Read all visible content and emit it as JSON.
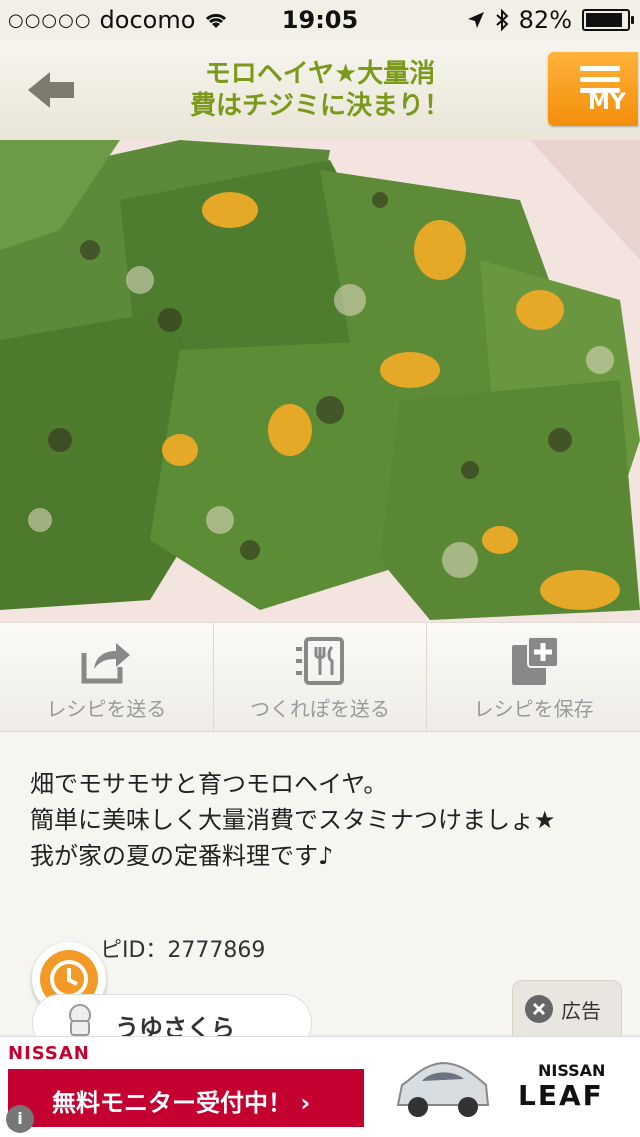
{
  "status": {
    "carrier": "docomo",
    "time": "19:05",
    "battery": "82%",
    "signal": "○○○○○"
  },
  "nav": {
    "title_line1": "モロヘイヤ★大量消",
    "title_line2": "費はチジミに決まり！",
    "my_label": "MY"
  },
  "actions": [
    {
      "label": "レシピを送る",
      "icon": "share-icon"
    },
    {
      "label": "つくれぽを送る",
      "icon": "tsukurepo-icon"
    },
    {
      "label": "レシピを保存",
      "icon": "save-recipe-icon"
    }
  ],
  "description": {
    "text": "畑でモサモサと育つモロヘイヤ。\n簡単に美味しく大量消費でスタミナつけましょ★\n我が家の夏の定番料理です♪",
    "recipe_id": "ピID：2777869",
    "author": "うゆさくら"
  },
  "ad": {
    "brand": "NISSAN",
    "cta": "無料モニター受付中！ ›",
    "brand2": "NISSAN",
    "model": "LEAF",
    "close_label": "広告",
    "info": "i"
  },
  "colors": {
    "title_green": "#7b9a1b",
    "my_orange": "#f38e0c",
    "nissan_red": "#c3002f"
  }
}
